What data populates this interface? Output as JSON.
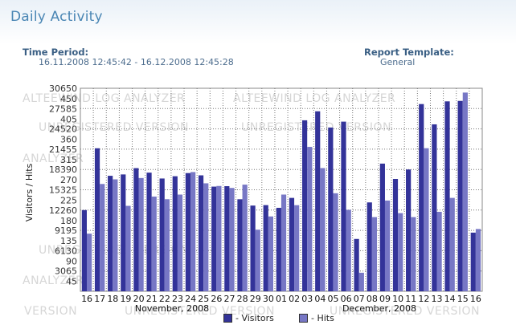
{
  "header": {
    "title": "Daily Activity",
    "time_period_label": "Time Period:",
    "time_period_value": "16.11.2008 12:45:42 - 16.12.2008 12:45:28",
    "report_template_label": "Report Template:",
    "report_template_value": "General"
  },
  "watermark": {
    "line1": "ALTEEWIND LOG ANALYZER",
    "line2": "UNREGISTERED VERSION",
    "short1": "ANALYZER",
    "short2": "VERSION",
    "mid1": "ALTEEWIND LOG ANALYZER",
    "mid2": "UNREGISTERED VERSION"
  },
  "chart_data": {
    "type": "bar",
    "ylabel": "Visitors / Hits",
    "categories": [
      "16",
      "17",
      "18",
      "19",
      "20",
      "21",
      "22",
      "23",
      "24",
      "25",
      "26",
      "27",
      "28",
      "29",
      "30",
      "01",
      "02",
      "03",
      "04",
      "05",
      "06",
      "07",
      "08",
      "09",
      "10",
      "11",
      "12",
      "13",
      "14",
      "15",
      "16"
    ],
    "month_labels": [
      "November, 2008",
      "December, 2008"
    ],
    "hits_ticks": [
      "30650",
      "27585",
      "24520",
      "21455",
      "18390",
      "15325",
      "12260",
      "9195",
      "6130",
      "3065"
    ],
    "visitors_ticks": [
      "450",
      "405",
      "360",
      "315",
      "270",
      "225",
      "180",
      "135",
      "90",
      "45"
    ],
    "hits_max": 30650,
    "visitors_max": 450,
    "series": [
      {
        "name": "Visitors",
        "color": "#333399",
        "values": [
          180,
          317,
          256,
          259,
          273,
          263,
          250,
          255,
          262,
          257,
          232,
          233,
          204,
          190,
          191,
          185,
          207,
          379,
          399,
          363,
          376,
          116,
          197,
          283,
          249,
          270,
          415,
          370,
          421,
          422,
          130
        ]
      },
      {
        "name": "Hits",
        "color": "#7777c5",
        "values": [
          8700,
          16200,
          16900,
          12900,
          17100,
          14300,
          13900,
          14600,
          18000,
          16300,
          15900,
          15600,
          16100,
          9300,
          11300,
          14600,
          13000,
          21800,
          18600,
          14800,
          12300,
          2800,
          11200,
          13700,
          11800,
          11200,
          21600,
          12000,
          14100,
          30000,
          9400
        ]
      }
    ],
    "legend": [
      {
        "label": "- Visitors",
        "color": "#333399"
      },
      {
        "label": "- Hits",
        "color": "#7777c5"
      }
    ],
    "legend_position": "bottom",
    "grid": true
  }
}
